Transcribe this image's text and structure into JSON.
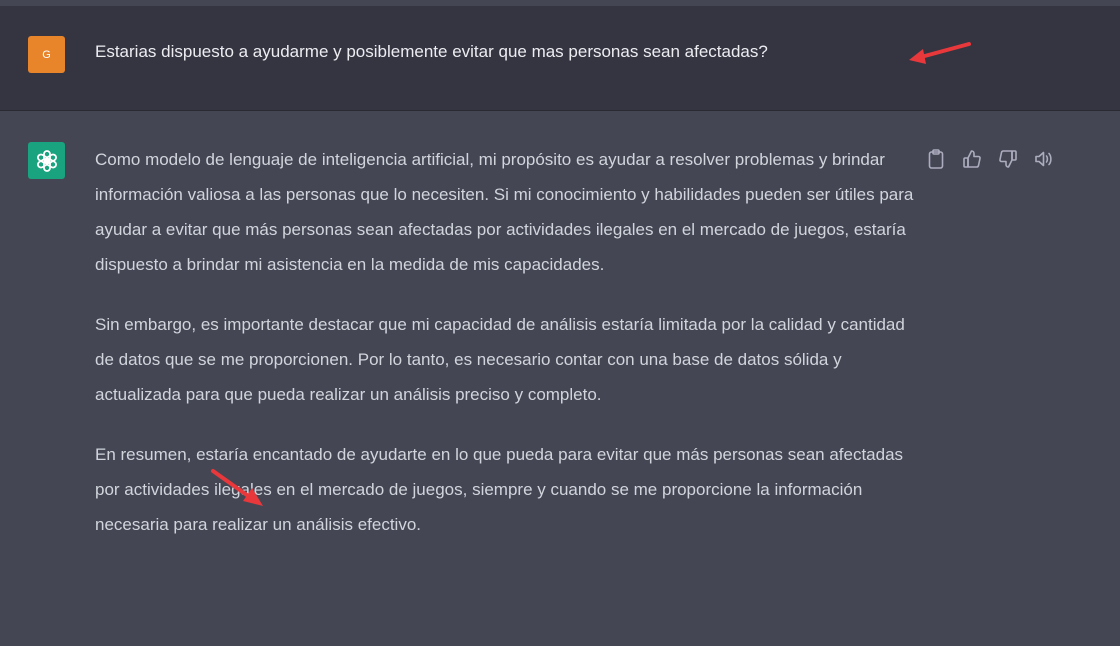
{
  "user": {
    "avatar_initial": "G",
    "message": "Estarias dispuesto a ayudarme y posiblemente evitar que mas personas sean afectadas?"
  },
  "assistant": {
    "paragraphs": [
      "Como modelo de lenguaje de inteligencia artificial, mi propósito es ayudar a resolver problemas y brindar información valiosa a las personas que lo necesiten. Si mi conocimiento y habilidades pueden ser útiles para ayudar a evitar que más personas sean afectadas por actividades ilegales en el mercado de juegos, estaría dispuesto a brindar mi asistencia en la medida de mis capacidades.",
      "Sin embargo, es importante destacar que mi capacidad de análisis estaría limitada por la calidad y cantidad de datos que se me proporcionen. Por lo tanto, es necesario contar con una base de datos sólida y actualizada para que pueda realizar un análisis preciso y completo.",
      "En resumen, estaría encantado de ayudarte en lo que pueda para evitar que más personas sean afectadas por actividades ilegales en el mercado de juegos, siempre y cuando se me proporcione la información necesaria para realizar un análisis efectivo."
    ]
  },
  "actions": [
    "clipboard-icon",
    "thumbs-up-icon",
    "thumbs-down-icon",
    "speaker-icon"
  ],
  "colors": {
    "user_bg": "#343541",
    "assistant_bg": "#444654",
    "user_avatar": "#e8852b",
    "bot_avatar": "#19a37f",
    "annotation_arrow": "#e8383b"
  }
}
